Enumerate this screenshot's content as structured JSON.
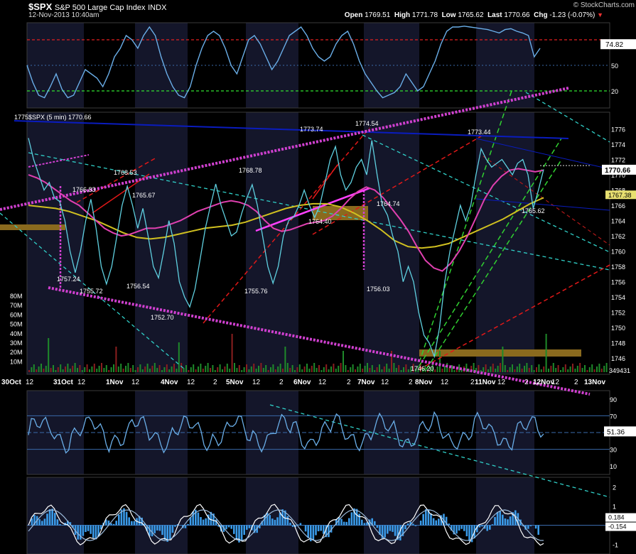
{
  "header": {
    "symbol": "$SPX",
    "name": "S&P 500 Large Cap Index",
    "exchange": "INDX",
    "datetime": "12-Nov-2013 10:40am",
    "open_label": "Open",
    "open": "1769.51",
    "high_label": "High",
    "high": "1771.78",
    "low_label": "Low",
    "low": "1765.62",
    "last_label": "Last",
    "last": "1770.66",
    "chg_label": "Chg",
    "chg": "-1.23 (-0.07%)",
    "watermark": "© StockCharts.com",
    "price_legend": "$SPX (5 min) 1770.66"
  },
  "colors": {
    "background": "#000000",
    "price": "#5fd0e0",
    "ema_fast": "#e040b0",
    "ema_slow": "#d0c020",
    "downtrend_blue": "#0a1cbe",
    "dotted_magenta": "#d040d0",
    "red_channel": "#e01818",
    "green_channel": "#30d030",
    "cyan_dashed": "#30d0c8",
    "rsi_line": "#6aaee8",
    "gold_zone": "#8a6a1e",
    "volume_green": "#1f8a2a",
    "volume_red": "#8a1f1f"
  },
  "chart_data": [
    {
      "type": "line",
      "panel": "top-indicator",
      "series": [],
      "y_ticks": [
        "50",
        "20"
      ],
      "levels": [
        80,
        50,
        20
      ],
      "last_value": "74.82",
      "ylim": [
        0,
        100
      ]
    },
    {
      "type": "line",
      "panel": "price",
      "title": "$SPX (5 min) 1770.66",
      "x_tick_labels": [
        "30Oct",
        "12",
        "31Oct",
        "12",
        "1Nov",
        "12",
        "4Nov",
        "12",
        "2",
        "5Nov",
        "12",
        "2",
        "6Nov",
        "12",
        "2",
        "7Nov",
        "12",
        "2",
        "8Nov",
        "12",
        "2",
        "11Nov",
        "12",
        "2",
        "12Nov",
        "12",
        "2",
        "13Nov"
      ],
      "y_ticks": [
        1746,
        1748,
        1750,
        1752,
        1754,
        1756,
        1758,
        1760,
        1762,
        1764,
        1766,
        1768,
        1770,
        1772,
        1774,
        1776
      ],
      "ylim": [
        1745,
        1778
      ],
      "last_value": "1770.66",
      "marker_value": "1767.38",
      "annotations": [
        "1775",
        "1766.83",
        "1768.53",
        "1765.67",
        "1757.24",
        "1755.72",
        "1756.54",
        "1752.70",
        "1768.78",
        "1755.76",
        "1773.74",
        "1764.40",
        "1774.54",
        "1764.74",
        "1756.03",
        "1746.20",
        "1773.44",
        "1765.62"
      ],
      "volume_ticks": [
        "80M",
        "70M",
        "60M",
        "50M",
        "40M",
        "30M",
        "20M",
        "10M"
      ],
      "volume_last": "349431",
      "series": [
        {
          "values": [
            1774.8,
            1772,
            1770,
            1768,
            1769,
            1767,
            1766.5,
            1764,
            1760,
            1757.2,
            1760,
            1764,
            1766.8,
            1763,
            1758,
            1755.7,
            1758,
            1762,
            1766,
            1768.5,
            1766,
            1763,
            1765.6,
            1762,
            1758,
            1756.5,
            1760,
            1764,
            1761,
            1756,
            1754,
            1752.7,
            1755,
            1759,
            1763,
            1766,
            1768.8,
            1766,
            1764,
            1762,
            1762.5,
            1765,
            1767,
            1768.7,
            1766,
            1762,
            1758,
            1755.8,
            1758,
            1762,
            1764,
            1764.5,
            1766,
            1768,
            1766,
            1764.4,
            1766,
            1769,
            1772,
            1773.7,
            1770,
            1768,
            1769,
            1771,
            1772,
            1770,
            1774.5,
            1770,
            1766,
            1764.7,
            1762,
            1760,
            1756,
            1758,
            1756,
            1752,
            1749,
            1748,
            1746.2,
            1750,
            1756,
            1760,
            1763,
            1766,
            1764,
            1766,
            1770,
            1773.4,
            1772,
            1771,
            1771.5,
            1772,
            1771,
            1770,
            1771.5,
            1772,
            1770,
            1765.6,
            1768,
            1770.7
          ]
        },
        {
          "values": [
            1770,
            1769.6,
            1769,
            1768.2,
            1767.4,
            1766.6,
            1766,
            1765,
            1764,
            1763,
            1762.4,
            1762,
            1762.2,
            1762.6,
            1763,
            1763,
            1763.2,
            1763.6,
            1764,
            1764.6,
            1765.2,
            1765.6,
            1766,
            1766.4,
            1766.6,
            1766.4,
            1766,
            1765.2,
            1764,
            1763,
            1762.6,
            1762.8,
            1763.2,
            1763.6,
            1763.8,
            1764,
            1764.6,
            1765.6,
            1766.8,
            1767.8,
            1768.4,
            1768,
            1767,
            1765.6,
            1764.2,
            1762.6,
            1760.6,
            1758.8,
            1757.8,
            1757.4,
            1758.4,
            1760,
            1762,
            1764.4,
            1766.8,
            1768.6,
            1769.8,
            1770.6,
            1770.8,
            1770.6,
            1770.4,
            1770.6
          ]
        },
        {
          "values": [
            1766,
            1765.8,
            1765.6,
            1765.2,
            1764.6,
            1764,
            1763.2,
            1762.4,
            1761.8,
            1761.6,
            1761.8,
            1762.2,
            1762.6,
            1763,
            1763.2,
            1763.4,
            1763.8,
            1764.4,
            1765,
            1765.6,
            1766,
            1766.2,
            1766.2,
            1765.8,
            1765,
            1764,
            1762.8,
            1761.4,
            1760.6,
            1760.4,
            1760.6,
            1761,
            1761.8,
            1762.6,
            1763.4,
            1764.2,
            1765.2,
            1766.2,
            1767
          ]
        }
      ]
    },
    {
      "type": "line",
      "panel": "rsi",
      "series": [],
      "y_ticks": [
        "90",
        "70",
        "50",
        "30",
        "10"
      ],
      "levels": [
        70,
        50,
        30
      ],
      "last_value": "51.36",
      "ylim": [
        0,
        100
      ]
    },
    {
      "type": "line",
      "panel": "macd",
      "series": [],
      "y_ticks": [
        "2",
        "1",
        "0",
        "-1"
      ],
      "last_values": [
        "0.184",
        "-0.154"
      ],
      "ylim": [
        -1.5,
        2.5
      ]
    }
  ]
}
